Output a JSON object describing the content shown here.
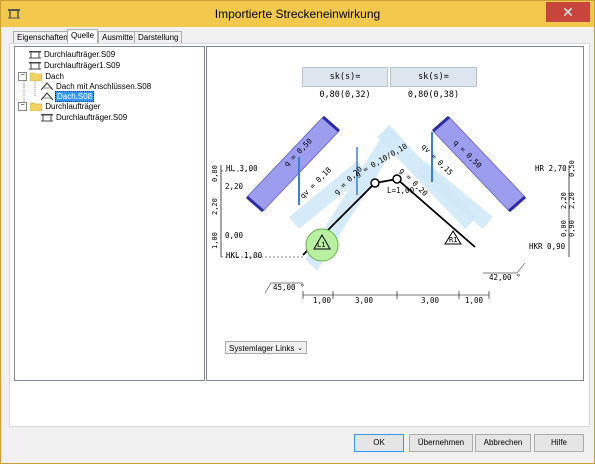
{
  "window": {
    "title": "Importierte Streckeneinwirkung",
    "close_glyph": "✕"
  },
  "tabs": [
    {
      "label": "Eigenschaften"
    },
    {
      "label": "Quelle"
    },
    {
      "label": "Ausmitte"
    },
    {
      "label": "Darstellung"
    }
  ],
  "tree": {
    "items": [
      {
        "label": "Durchlaufträger.S09",
        "icon": "beam-icon"
      },
      {
        "label": "Durchlaufträger1.S09",
        "icon": "beam-icon"
      },
      {
        "label": "Dach",
        "icon": "folder-icon",
        "expander": "−"
      },
      {
        "label": "Dach mit Anschlüssen.S08",
        "icon": "roof-icon"
      },
      {
        "label": "Dach.S08",
        "icon": "roof-icon",
        "selected": true
      },
      {
        "label": "Durchlaufträger",
        "icon": "folder-icon",
        "expander": "−"
      },
      {
        "label": "Durchlaufträger.S09",
        "icon": "beam-icon"
      }
    ]
  },
  "drawing": {
    "sk_left": "sk(s)= 0,80(0,32)",
    "sk_right": "sk(s)= 0,80(0,38)",
    "left_loads": {
      "q": "q = 0,50",
      "qv": "qv = 0,18",
      "g": "g = 0,20"
    },
    "right_loads": {
      "q": "q = 0,50",
      "qv": "qv = 0,15",
      "g": "g = 0,20"
    },
    "top_label": "g = 0,10/0,10",
    "ridge_length": "L=1,00",
    "support_left": "L1",
    "support_right": "R1",
    "hl": "HL 3,00",
    "hkl": "HKL 1,00",
    "hr": "HR 2,70",
    "hkr": "HKR 0,90",
    "left_dims": [
      "0,80",
      "2,20",
      "2,20",
      "0,00",
      "1,00"
    ],
    "right_dims": [
      "0,50",
      "2,20",
      "2,20",
      "0,90",
      "0,00"
    ],
    "angle_left": "45,00 °",
    "angle_right": "42,00 °",
    "bottom_dims": [
      "1,00",
      "3,00",
      "3,00",
      "1,00"
    ]
  },
  "select": {
    "value": "Systemlager Links",
    "arrow": "⌄"
  },
  "buttons": {
    "ok": "OK",
    "apply": "Übernehmen",
    "cancel": "Abbrechen",
    "help": "Hilfe"
  },
  "colors": {
    "titlebar": "#f2c94c",
    "selection": "#3399ff",
    "load_purple": "#9999ee",
    "load_blue": "#bfe0f5",
    "support_green": "#b8f0a0"
  }
}
